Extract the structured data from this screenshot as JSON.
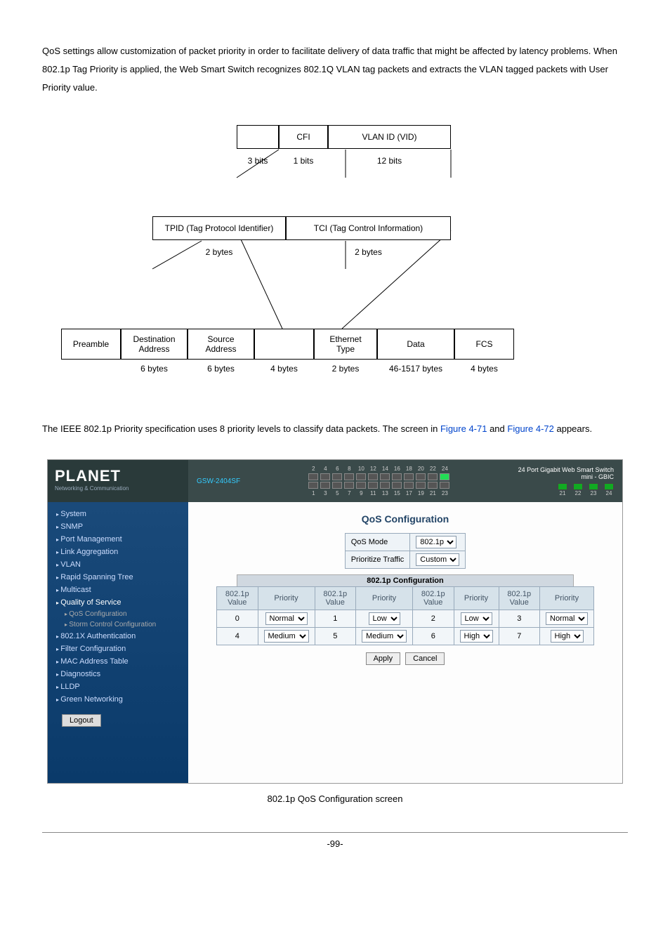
{
  "para1": "QoS settings allow customization of packet priority in order to facilitate delivery of data traffic that might be affected by latency problems. When 802.1p Tag Priority is applied, the Web Smart Switch recognizes 802.1Q VLAN tag packets and extracts the VLAN tagged packets with User Priority value.",
  "diagram": {
    "row1": {
      "blank": " ",
      "cfi": "CFI",
      "vlan": "VLAN ID (VID)",
      "bits3": "3 bits",
      "bits1": "1 bits",
      "bits12": "12 bits"
    },
    "row2": {
      "tpid": "TPID (Tag Protocol Identifier)",
      "tci": "TCI (Tag Control Information)",
      "b2a": "2 bytes",
      "b2b": "2 bytes"
    },
    "row3": {
      "preamble": "Preamble",
      "dest": "Destination Address",
      "src": "Source Address",
      "blank": " ",
      "eth": "Ethernet Type",
      "data": "Data",
      "fcs": "FCS",
      "l1": "6 bytes",
      "l2": "6 bytes",
      "l3": "4 bytes",
      "l4": "2 bytes",
      "l5": "46-1517 bytes",
      "l6": "4 bytes"
    }
  },
  "para2_pre": "The IEEE 802.1p Priority specification uses 8 priority levels to classify data packets. The screen in ",
  "link1": "Figure 4-71",
  "para2_mid": " and ",
  "link2": "Figure 4-72",
  "para2_post": " appears.",
  "screenshot": {
    "model": "GSW-2404SF",
    "brand": "PLANET",
    "brand_sub": "Networking & Communication",
    "top_port_nums": [
      "2",
      "4",
      "6",
      "8",
      "10",
      "12",
      "14",
      "16",
      "18",
      "20",
      "22",
      "24"
    ],
    "bot_port_nums": [
      "1",
      "3",
      "5",
      "7",
      "9",
      "11",
      "13",
      "15",
      "17",
      "19",
      "21",
      "23"
    ],
    "right1": "24 Port Gigabit Web Smart Switch",
    "right2": "mini - GBIC",
    "led_labels": [
      "21",
      "22",
      "23",
      "24"
    ],
    "nav": [
      "System",
      "SNMP",
      "Port Management",
      "Link Aggregation",
      "VLAN",
      "Rapid Spanning Tree",
      "Multicast",
      "Quality of Service"
    ],
    "nav_sub": [
      "QoS Configuration",
      "Storm Control Configuration"
    ],
    "nav2": [
      "802.1X Authentication",
      "Filter Configuration",
      "MAC Address Table",
      "Diagnostics",
      "LLDP",
      "Green Networking"
    ],
    "logout": "Logout",
    "main_title": "QoS Configuration",
    "ctrl_rows": [
      {
        "label": "QoS Mode",
        "value": "802.1p"
      },
      {
        "label": "Prioritize Traffic",
        "value": "Custom"
      }
    ],
    "ptable_title": "802.1p Configuration",
    "ptable_head": [
      "802.1p Value",
      "Priority",
      "802.1p Value",
      "Priority",
      "802.1p Value",
      "Priority",
      "802.1p Value",
      "Priority"
    ],
    "ptable_rows": [
      [
        "0",
        "Normal",
        "1",
        "Low",
        "2",
        "Low",
        "3",
        "Normal"
      ],
      [
        "4",
        "Medium",
        "5",
        "Medium",
        "6",
        "High",
        "7",
        "High"
      ]
    ],
    "apply": "Apply",
    "cancel": "Cancel"
  },
  "caption": "802.1p QoS Configuration screen",
  "page_num": "-99-"
}
